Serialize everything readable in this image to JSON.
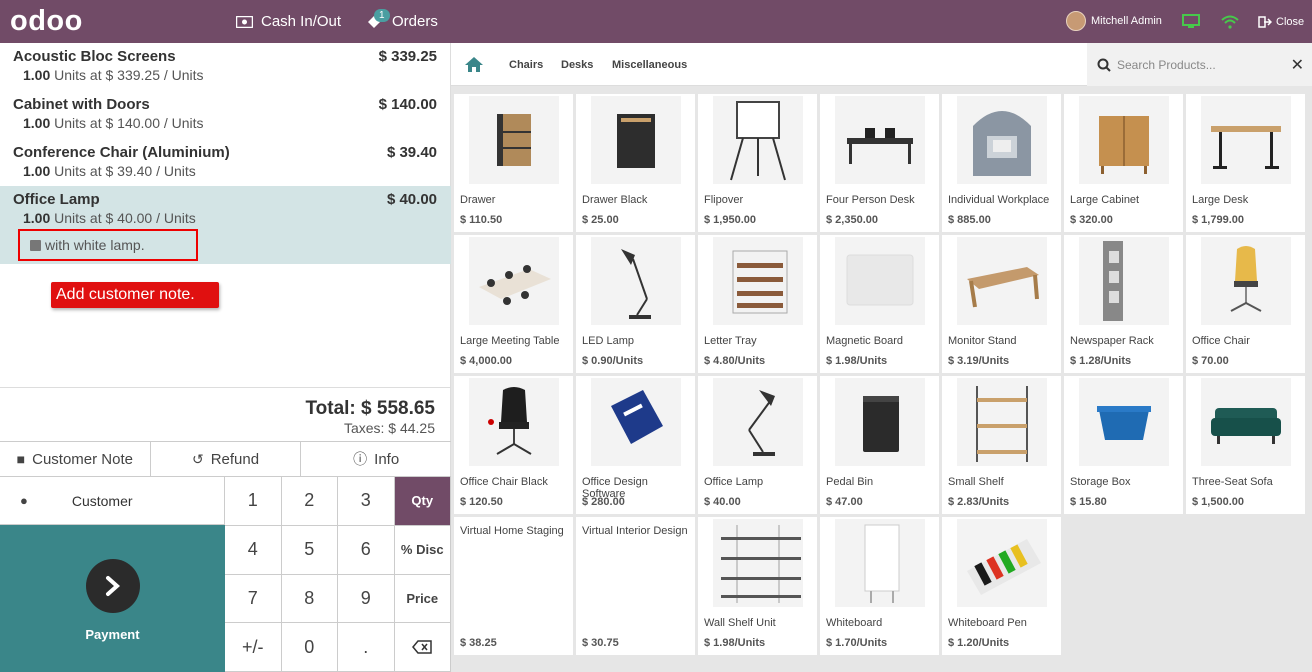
{
  "topbar": {
    "logo": "odoo",
    "cash_label": "Cash In/Out",
    "orders_label": "Orders",
    "orders_badge": "1",
    "user_name": "Mitchell Admin",
    "close_label": "Close",
    "color": "#714B67"
  },
  "order": {
    "lines": [
      {
        "name": "Acoustic Bloc Screens",
        "price": "$ 339.25",
        "qty": "1.00",
        "info": "Units at $ 339.25 / Units"
      },
      {
        "name": "Cabinet with Doors",
        "price": "$ 140.00",
        "qty": "1.00",
        "info": "Units at $ 140.00 / Units"
      },
      {
        "name": "Conference Chair (Aluminium)",
        "price": "$ 39.40",
        "qty": "1.00",
        "info": "Units at $ 39.40 / Units"
      },
      {
        "name": "Office Lamp",
        "price": "$ 40.00",
        "qty": "1.00",
        "info": "Units at $ 40.00 / Units",
        "note": "with white lamp.",
        "selected": true
      }
    ],
    "callout": "Add customer note.",
    "total": "Total: $ 558.65",
    "taxes": "Taxes: $ 44.25"
  },
  "controls": {
    "customer_note": "Customer Note",
    "refund": "Refund",
    "info": "Info",
    "customer": "Customer",
    "payment": "Payment"
  },
  "numpad": {
    "keys": [
      "1",
      "2",
      "3",
      "4",
      "5",
      "6",
      "7",
      "8",
      "9",
      "+/-",
      "0",
      "."
    ],
    "modes": [
      "Qty",
      "% Disc",
      "Price"
    ],
    "active_mode": "Qty"
  },
  "categories": [
    "Chairs",
    "Desks",
    "Miscellaneous"
  ],
  "search": {
    "placeholder": "Search Products..."
  },
  "products": [
    {
      "name": "Drawer",
      "price": "$ 110.50",
      "icon": "drawer"
    },
    {
      "name": "Drawer Black",
      "price": "$ 25.00",
      "icon": "drawer-black"
    },
    {
      "name": "Flipover",
      "price": "$ 1,950.00",
      "icon": "flipover"
    },
    {
      "name": "Four Person Desk",
      "price": "$ 2,350.00",
      "icon": "four-person-desk"
    },
    {
      "name": "Individual Workplace",
      "price": "$ 885.00",
      "icon": "workplace"
    },
    {
      "name": "Large Cabinet",
      "price": "$ 320.00",
      "icon": "cabinet"
    },
    {
      "name": "Large Desk",
      "price": "$ 1,799.00",
      "icon": "desk"
    },
    {
      "name": "Large Meeting Table",
      "price": "$ 4,000.00",
      "icon": "meeting-table"
    },
    {
      "name": "LED Lamp",
      "price": "$ 0.90/Units",
      "icon": "lamp"
    },
    {
      "name": "Letter Tray",
      "price": "$ 4.80/Units",
      "icon": "letter-tray"
    },
    {
      "name": "Magnetic Board",
      "price": "$ 1.98/Units",
      "icon": "board"
    },
    {
      "name": "Monitor Stand",
      "price": "$ 3.19/Units",
      "icon": "monitor-stand"
    },
    {
      "name": "Newspaper Rack",
      "price": "$ 1.28/Units",
      "icon": "rack"
    },
    {
      "name": "Office Chair",
      "price": "$ 70.00",
      "icon": "chair"
    },
    {
      "name": "Office Chair Black",
      "price": "$ 120.50",
      "icon": "chair-black"
    },
    {
      "name": "Office Design Software",
      "price": "$ 280.00",
      "icon": "software"
    },
    {
      "name": "Office Lamp",
      "price": "$ 40.00",
      "icon": "desk-lamp"
    },
    {
      "name": "Pedal Bin",
      "price": "$ 47.00",
      "icon": "bin"
    },
    {
      "name": "Small Shelf",
      "price": "$ 2.83/Units",
      "icon": "shelf"
    },
    {
      "name": "Storage Box",
      "price": "$ 15.80",
      "icon": "box"
    },
    {
      "name": "Three-Seat Sofa",
      "price": "$ 1,500.00",
      "icon": "sofa"
    },
    {
      "name": "Virtual Home Staging",
      "price": "$ 38.25",
      "icon": ""
    },
    {
      "name": "Virtual Interior Design",
      "price": "$ 30.75",
      "icon": ""
    },
    {
      "name": "Wall Shelf Unit",
      "price": "$ 1.98/Units",
      "icon": "wall-shelf"
    },
    {
      "name": "Whiteboard",
      "price": "$ 1.70/Units",
      "icon": "whiteboard"
    },
    {
      "name": "Whiteboard Pen",
      "price": "$ 1.20/Units",
      "icon": "pens"
    }
  ]
}
